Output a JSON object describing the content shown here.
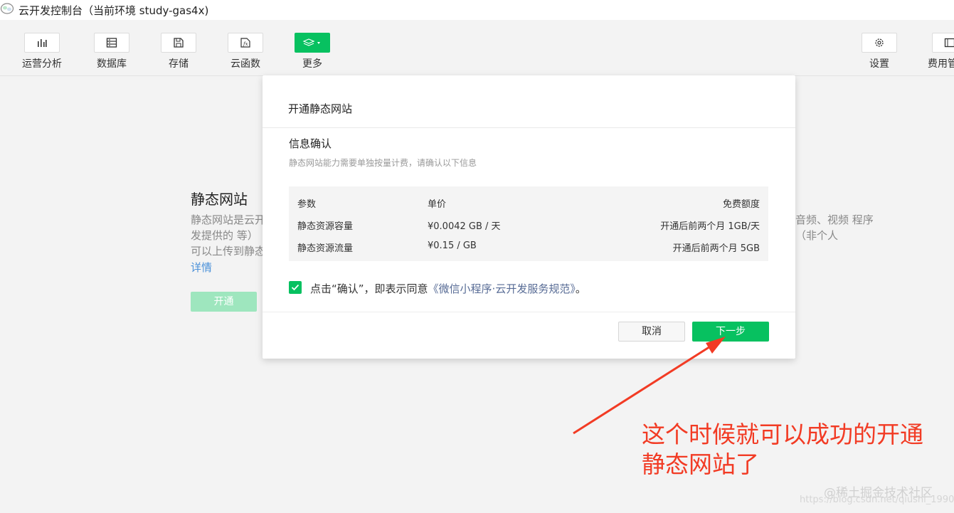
{
  "window": {
    "title": "云开发控制台（当前环境 study-gas4x)"
  },
  "toolbar": {
    "items": [
      {
        "label": "运营分析",
        "icon": "bar-chart-icon"
      },
      {
        "label": "数据库",
        "icon": "database-icon"
      },
      {
        "label": "存储",
        "icon": "save-icon"
      },
      {
        "label": "云函数",
        "icon": "function-icon"
      },
      {
        "label": "更多",
        "icon": "layers-icon"
      },
      {
        "label": "设置",
        "icon": "gear-icon"
      },
      {
        "label": "费用管",
        "icon": "billing-icon"
      }
    ],
    "accent_color": "#07c160"
  },
  "background": {
    "title": "静态网站",
    "desc_left": "静态网站是云开发提供的 等）可以上传到静态网站托管 主体）、安全",
    "desc_right": "音频、视频 程序（非个人",
    "link": "详情",
    "open_button": "开通"
  },
  "modal": {
    "tab": "开通静态网站",
    "section_title": "信息确认",
    "section_subtitle": "静态网站能力需要单独按量计费，请确认以下信息",
    "table": {
      "headers": [
        "参数",
        "单价",
        "免费额度"
      ],
      "rows": [
        [
          "静态资源容量",
          "¥0.0042 GB / 天",
          "开通后前两个月 1GB/天"
        ],
        [
          "静态资源流量",
          "¥0.15 / GB",
          "开通后前两个月 5GB"
        ]
      ]
    },
    "agreement_prefix": "点击“确认”，即表示同意",
    "agreement_link": "《微信小程序·云开发服务规范》",
    "agreement_suffix": "。",
    "checked": true,
    "cancel_label": "取消",
    "next_label": "下一步"
  },
  "annotation": {
    "line1": "这个时候就可以成功的开通",
    "line2": "静态网站了",
    "color": "#f23b24"
  },
  "watermark": {
    "text": "@稀土掘金技术社区",
    "url": "https://blog.csdn.net/qiushi_1990"
  }
}
